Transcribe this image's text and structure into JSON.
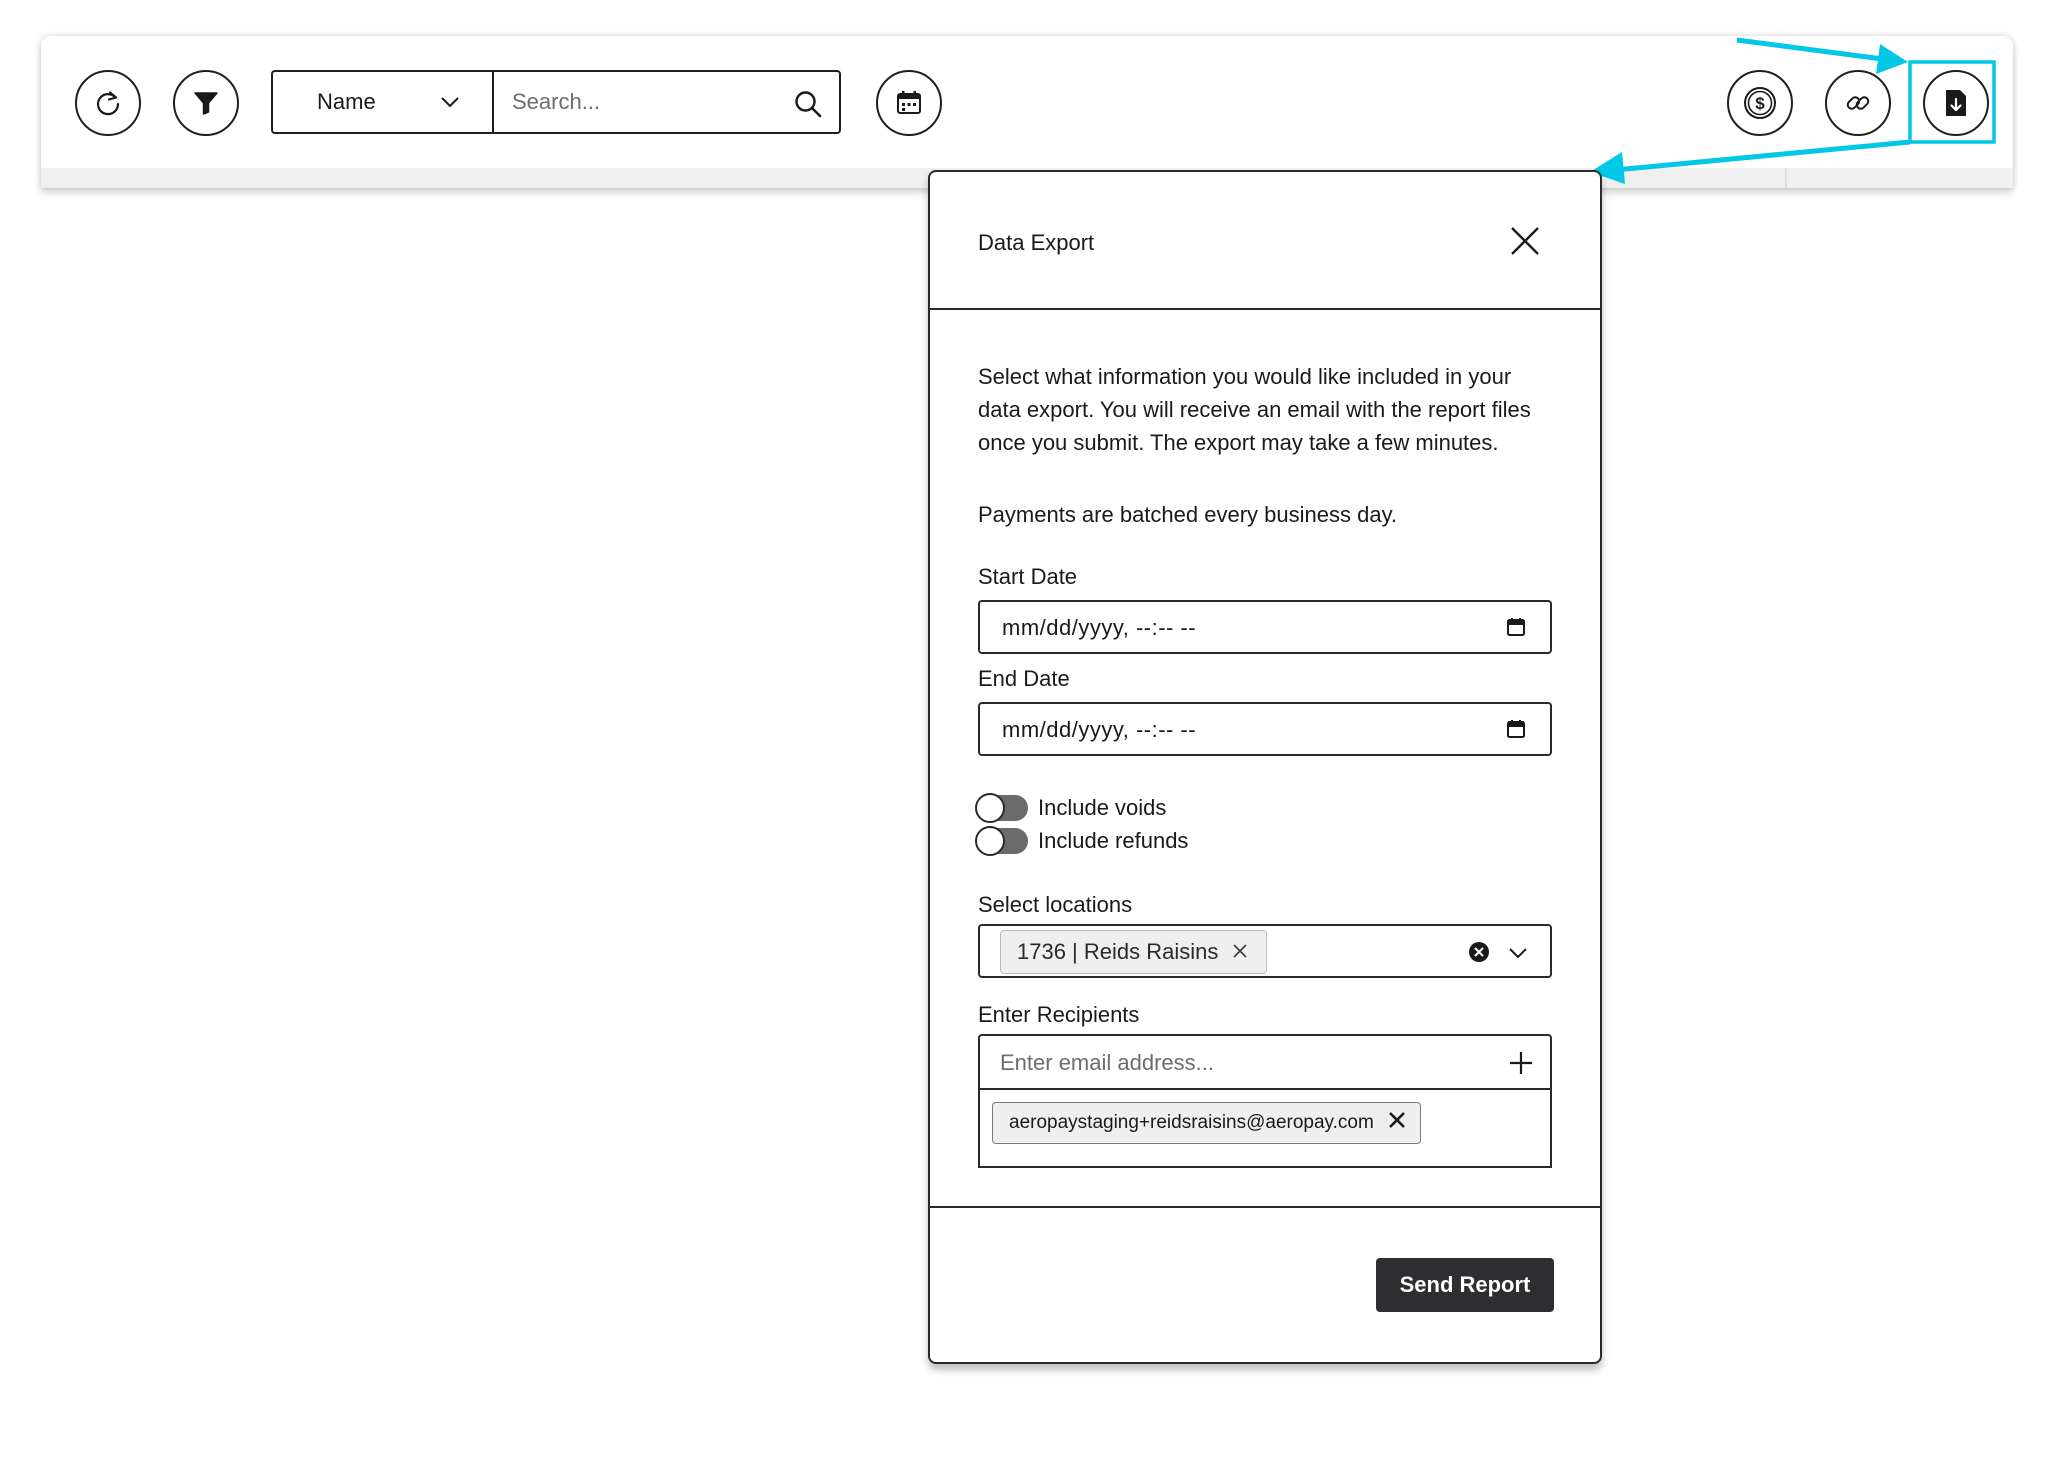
{
  "toolbar": {
    "field_select": {
      "label": "Name"
    },
    "search": {
      "placeholder": "Search..."
    },
    "buttons": [
      "refresh-icon",
      "filter-icon",
      "calendar-icon",
      "dollar-icon",
      "link-icon",
      "file-download-icon"
    ]
  },
  "annotation": {
    "color": "#00c8e6"
  },
  "modal": {
    "title": "Data Export",
    "description": "Select what information you would like included in your data export. You will receive an email with the report files once you submit. The export may take a few minutes.",
    "note": "Payments are batched every business day.",
    "start_date": {
      "label": "Start Date",
      "placeholder": "mm/dd/yyyy, --:-- --"
    },
    "end_date": {
      "label": "End Date",
      "placeholder": "mm/dd/yyyy, --:-- --"
    },
    "toggles": [
      {
        "label": "Include voids",
        "on": false
      },
      {
        "label": "Include refunds",
        "on": false
      }
    ],
    "locations": {
      "label": "Select locations",
      "selected": [
        "1736 | Reids Raisins"
      ]
    },
    "recipients": {
      "label": "Enter Recipients",
      "placeholder": "Enter email address...",
      "emails": [
        "aeropaystaging+reidsraisins@aeropay.com"
      ]
    },
    "submit_label": "Send Report"
  },
  "colors": {
    "primary_button": "#2e2e31",
    "toggle_off": "#6b6b6b"
  }
}
